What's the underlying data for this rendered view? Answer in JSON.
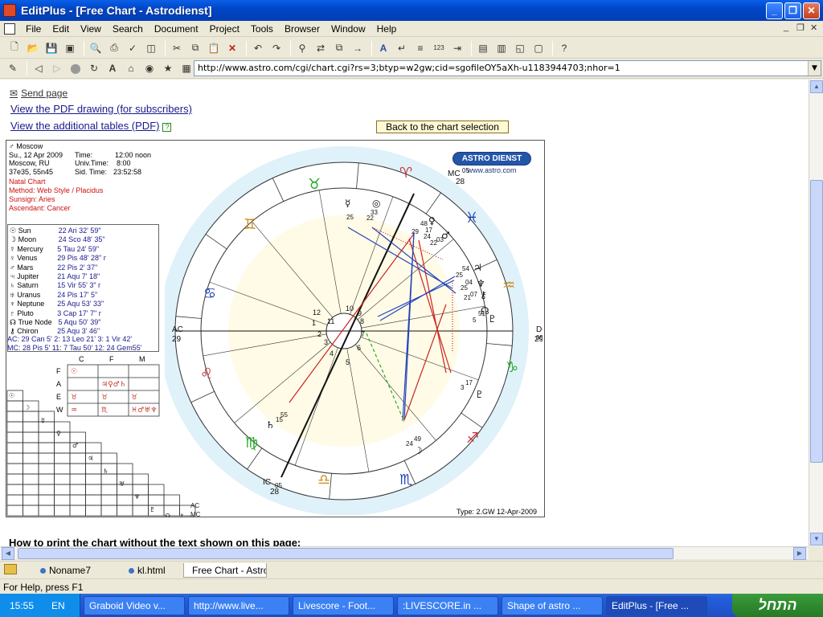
{
  "window": {
    "title": "EditPlus - [Free Chart - Astrodienst]",
    "controls": {
      "minimize": "_",
      "restore": "❐",
      "close": "✕"
    }
  },
  "menu": [
    "File",
    "Edit",
    "View",
    "Search",
    "Document",
    "Project",
    "Tools",
    "Browser",
    "Window",
    "Help"
  ],
  "address": {
    "url": "http://www.astro.com/cgi/chart.cgi?rs=3;btyp=w2gw;cid=sgofileOY5aXh-u1183944703;nhor=1"
  },
  "page": {
    "send_page": "Send page",
    "pdf_link": "View the PDF drawing (for subscribers)",
    "tables_link": "View the additional tables (PDF)",
    "back_button": "Back to the chart selection",
    "bottom_heading": "How to print the chart without the text shown on this page:"
  },
  "chart": {
    "header": {
      "location": "Moscow",
      "date_line": "Su., 12 Apr 2009",
      "time_label": "Time:",
      "time_value": "12:00 noon",
      "place_line": "Moscow, RU",
      "univ_label": "Univ.Time:",
      "univ_value": "8:00",
      "coords": "37e35, 55n45",
      "sid_label": "Sid. Time:",
      "sid_value": "23:52:58",
      "natal": "Natal Chart",
      "method": "Method: Web Style / Placidus",
      "sunsign": "Sunsign: Aries",
      "ascendant": "Ascendant: Cancer"
    },
    "planets": [
      {
        "name": "Sun",
        "pos": "22  Ari  32' 59\""
      },
      {
        "name": "Moon",
        "pos": "24  Sco  48' 35\""
      },
      {
        "name": "Mercury",
        "pos": "5  Tau  24' 59\""
      },
      {
        "name": "Venus",
        "pos": "29  Pis  48' 28\" r"
      },
      {
        "name": "Mars",
        "pos": "22  Pis   2' 37\""
      },
      {
        "name": "Jupiter",
        "pos": "21 Aqu   7' 18\""
      },
      {
        "name": "Saturn",
        "pos": "15  Vir  55'  3\" r"
      },
      {
        "name": "Uranus",
        "pos": "24  Pis  17'  5\""
      },
      {
        "name": "Neptune",
        "pos": "25 Aqu 53' 33\""
      },
      {
        "name": "Pluto",
        "pos": "3 Cap  17'  7\" r"
      },
      {
        "name": "True Node",
        "pos": "5 Aqu 50' 39\""
      },
      {
        "name": "Chiron",
        "pos": "25 Aqu  3' 46\""
      }
    ],
    "cusps_line1": "AC: 29 Can   5'   2:  13 Leo  21'   3:   1  Vir  42'",
    "cusps_line2": "MC: 28  Pis   5'  11:   7 Tau  50'  12: 24 Gem55'",
    "element_table": {
      "cols": [
        "C",
        "F",
        "M"
      ],
      "rows": [
        "F",
        "A",
        "E",
        "W"
      ]
    },
    "brand_logo": "ASTRO DIENST",
    "brand_url": "www.astro.com",
    "axis_labels": {
      "mc": "MC",
      "mc_deg": "05",
      "mc_num": "28",
      "ac": "AC",
      "ac_num": "29",
      "ac_deg": "05",
      "dc": "DC",
      "dc_deg": "05",
      "dc_num": "29",
      "ic": "IC",
      "ic_deg": "05",
      "ic_num": "28"
    },
    "type_line": "Type: 2.GW  12-Apr-2009"
  },
  "tabs": [
    {
      "label": "Noname7"
    },
    {
      "label": "kl.html"
    },
    {
      "label": "Free Chart - Astro"
    }
  ],
  "status": "For Help, press F1",
  "taskbar": {
    "time": "15:55",
    "lang": "EN",
    "tasks": [
      "Graboid Video v...",
      "http://www.live...",
      "Livescore - Foot...",
      ":LIVESCORE.in ...",
      "Shape of astro ...",
      "EditPlus - [Free ..."
    ],
    "start": "התחל"
  }
}
